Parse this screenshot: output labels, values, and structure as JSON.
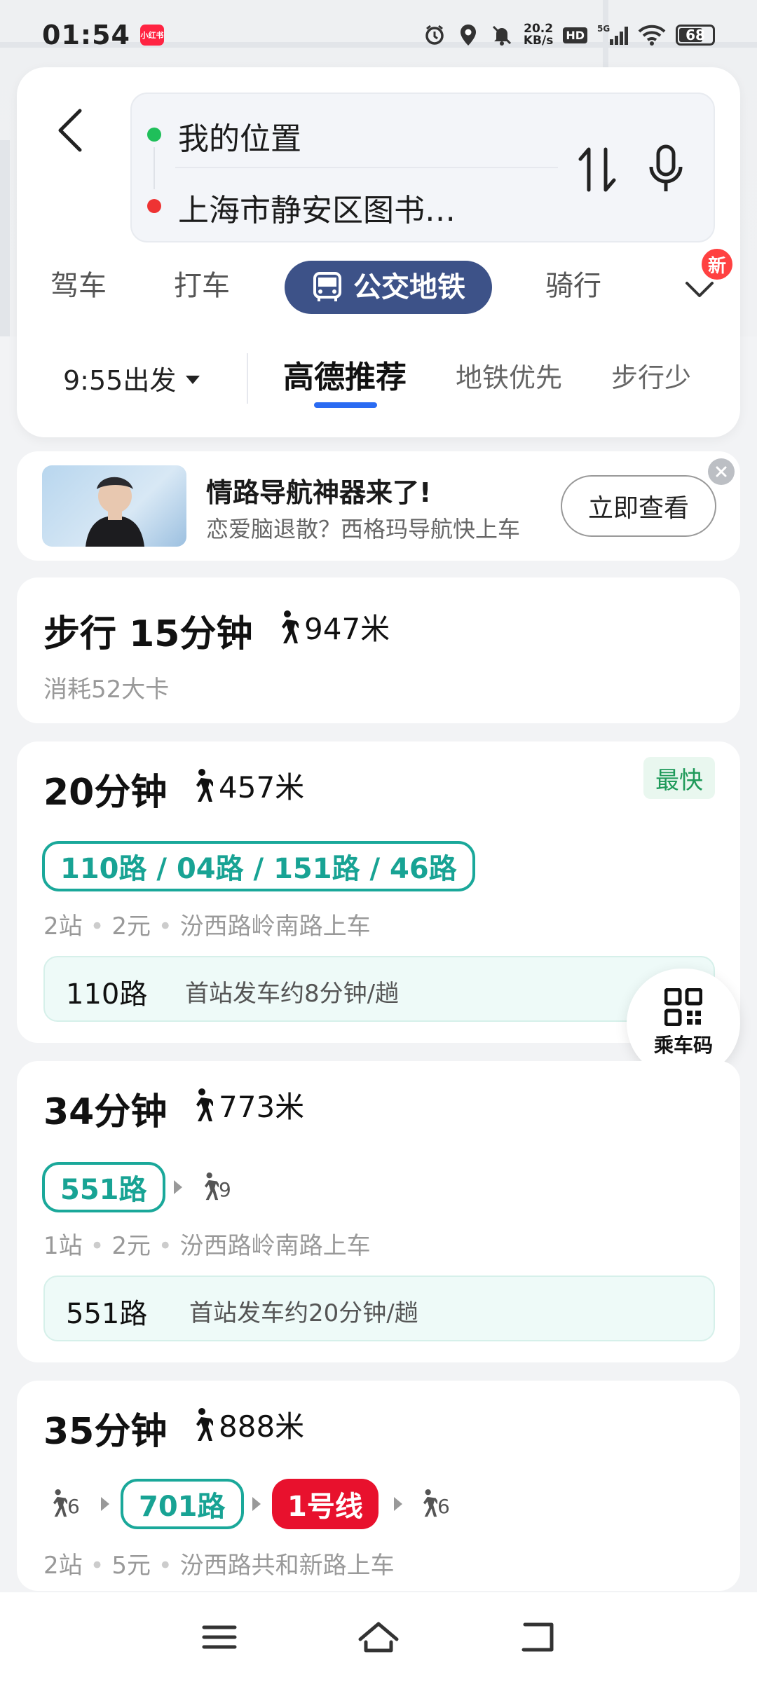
{
  "status_bar": {
    "time": "01:54",
    "app_badge": "小红书",
    "net_speed_value": "20.2",
    "net_speed_unit": "KB/s",
    "hd": "HD",
    "signal": "5G",
    "battery": "68"
  },
  "route": {
    "from": "我的位置",
    "to": "上海市静安区图书…"
  },
  "modes": {
    "drive": "驾车",
    "taxi": "打车",
    "bus": "公交地铁",
    "ride": "骑行",
    "new_badge": "新"
  },
  "prefs": {
    "depart": "9:55出发",
    "recommended": "高德推荐",
    "subway_first": "地铁优先",
    "less_walk": "步行少"
  },
  "promo": {
    "title": "情路导航神器来了!",
    "subtitle": "恋爱脑退散？西格玛导航快上车",
    "button": "立即查看"
  },
  "walk_route": {
    "title": "步行 15分钟",
    "distance": "947米",
    "calories": "消耗52大卡"
  },
  "routes": [
    {
      "duration": "20分钟",
      "walk": "457米",
      "tag": "最快",
      "lines": "110路 / 04路 / 151路 / 46路",
      "info_stops": "2站",
      "info_fare": "2元",
      "info_board": "汾西路岭南路上车",
      "depart_line": "110路",
      "depart_info": "首站发车约8分钟/趟"
    },
    {
      "duration": "34分钟",
      "walk": "773米",
      "line": "551路",
      "walk_after": "9",
      "info_stops": "1站",
      "info_fare": "2元",
      "info_board": "汾西路岭南路上车",
      "depart_line": "551路",
      "depart_info": "首站发车约20分钟/趟"
    },
    {
      "duration": "35分钟",
      "walk": "888米",
      "walk_before": "6",
      "bus_line": "701路",
      "subway_line": "1号线",
      "walk_after": "6",
      "info_stops": "2站",
      "info_fare": "5元",
      "info_board": "汾西路共和新路上车"
    }
  ],
  "qr": {
    "label": "乘车码"
  },
  "colors": {
    "accent_blue": "#2a6bf2",
    "bus_mode_bg": "#3d5288",
    "line_teal": "#18a394",
    "subway_red": "#e8112d",
    "fastest_green": "#1f9a5a"
  }
}
